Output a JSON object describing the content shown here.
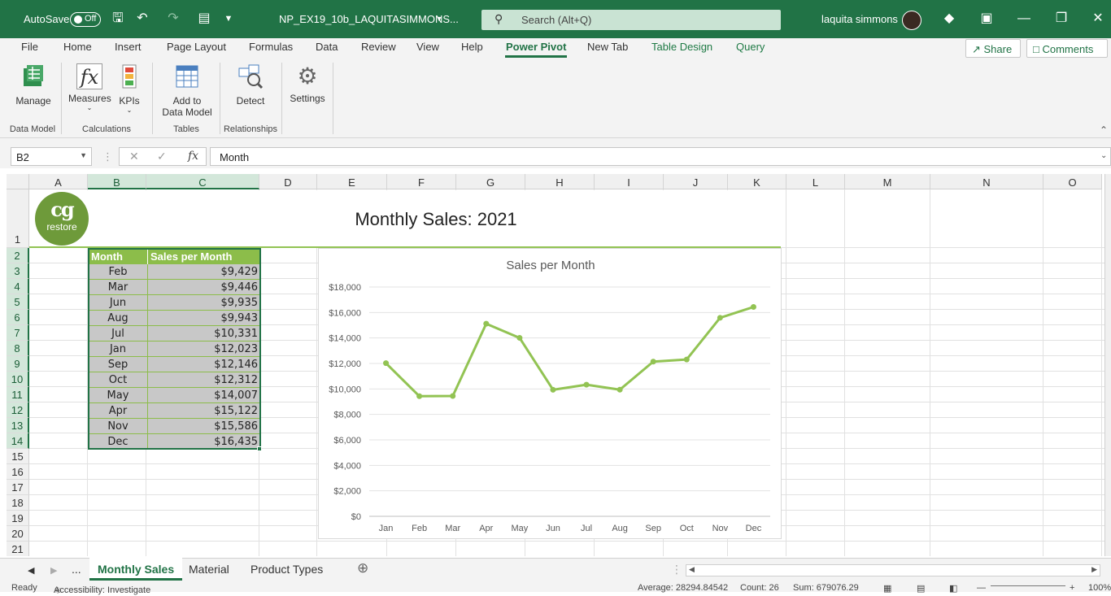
{
  "titlebar": {
    "autosave_label": "AutoSave",
    "autosave_state": "Off",
    "filename": "NP_EX19_10b_LAQUITASIMMONS...",
    "search_placeholder": "Search (Alt+Q)",
    "user_name": "laquita simmons"
  },
  "menu": {
    "tabs": [
      "File",
      "Home",
      "Insert",
      "Page Layout",
      "Formulas",
      "Data",
      "Review",
      "View",
      "Help",
      "Power Pivot",
      "New Tab",
      "Table Design",
      "Query"
    ],
    "active_tab": "Power Pivot",
    "share_label": "Share",
    "comments_label": "Comments"
  },
  "ribbon": {
    "manage": "Manage",
    "measures": "Measures",
    "kpis": "KPIs",
    "add_to_model_1": "Add to",
    "add_to_model_2": "Data Model",
    "detect": "Detect",
    "settings": "Settings",
    "groups": {
      "data_model": "Data Model",
      "calculations": "Calculations",
      "tables": "Tables",
      "relationships": "Relationships"
    }
  },
  "formula_bar": {
    "name_box": "B2",
    "formula": "Month"
  },
  "sheet": {
    "columns": [
      "A",
      "B",
      "C",
      "D",
      "E",
      "F",
      "G",
      "H",
      "I",
      "J",
      "K",
      "L",
      "M",
      "N",
      "O"
    ],
    "rows": [
      "1",
      "2",
      "3",
      "4",
      "5",
      "6",
      "7",
      "8",
      "9",
      "10",
      "11",
      "12",
      "13",
      "14",
      "15",
      "16",
      "17",
      "18",
      "19",
      "20",
      "21"
    ],
    "title": "Monthly Sales: 2021",
    "logo_big": "cg",
    "logo_small": "restore",
    "table": {
      "headers": [
        "Month",
        "Sales per Month"
      ],
      "rows": [
        [
          "Feb",
          "$9,429"
        ],
        [
          "Mar",
          "$9,446"
        ],
        [
          "Jun",
          "$9,935"
        ],
        [
          "Aug",
          "$9,943"
        ],
        [
          "Jul",
          "$10,331"
        ],
        [
          "Jan",
          "$12,023"
        ],
        [
          "Sep",
          "$12,146"
        ],
        [
          "Oct",
          "$12,312"
        ],
        [
          "May",
          "$14,007"
        ],
        [
          "Apr",
          "$15,122"
        ],
        [
          "Nov",
          "$15,586"
        ],
        [
          "Dec",
          "$16,435"
        ]
      ]
    }
  },
  "chart_data": {
    "type": "line",
    "title": "Sales per Month",
    "categories": [
      "Jan",
      "Feb",
      "Mar",
      "Apr",
      "May",
      "Jun",
      "Jul",
      "Aug",
      "Sep",
      "Oct",
      "Nov",
      "Dec"
    ],
    "values": [
      12023,
      9429,
      9446,
      15122,
      14007,
      9935,
      10331,
      9943,
      12146,
      12312,
      15586,
      16435
    ],
    "ylim": [
      0,
      18000
    ],
    "yticks": [
      "$0",
      "$2,000",
      "$4,000",
      "$6,000",
      "$8,000",
      "$10,000",
      "$12,000",
      "$14,000",
      "$16,000",
      "$18,000"
    ],
    "color": "#92c353",
    "grid": true
  },
  "sheet_tabs": {
    "ellipsis": "...",
    "tabs": [
      "Monthly Sales",
      "Material",
      "Product Types"
    ],
    "active": "Monthly Sales"
  },
  "status": {
    "ready": "Ready",
    "accessibility": "Accessibility: Investigate",
    "average": "Average: 28294.84542",
    "count": "Count: 26",
    "sum": "Sum: 679076.29",
    "zoom": "100%"
  },
  "colors": {
    "accent": "#217346",
    "table_header": "#8cbd4a",
    "table_fill": "#c8c8c8"
  }
}
